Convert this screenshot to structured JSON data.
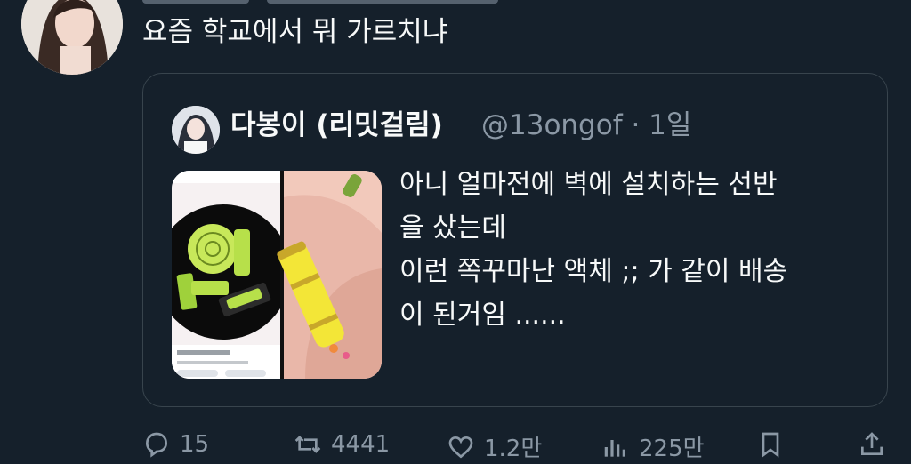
{
  "post": {
    "text": "요즘 학교에서 뭐 가르치냐"
  },
  "quoted": {
    "display_name": "다봉이 (리밋걸림)",
    "handle_time": "@13ongof · 1일",
    "body_lines": [
      "아니 얼마전에 벽에 설치하는 선반",
      "을 샀는데",
      "이런 쪽꾸마난 액체 ;; 가 같이 배송",
      "이 된거임 ......"
    ]
  },
  "actions": {
    "replies": "15",
    "reposts": "4441",
    "likes": "1.2만",
    "views": "225만"
  },
  "icons": [
    "reply-icon",
    "repost-icon",
    "like-icon",
    "views-icon",
    "bookmark-icon",
    "share-icon"
  ],
  "colors": {
    "background": "#15202b",
    "text": "#f7f9f9",
    "muted": "#8b98a5",
    "border": "#38444d"
  }
}
